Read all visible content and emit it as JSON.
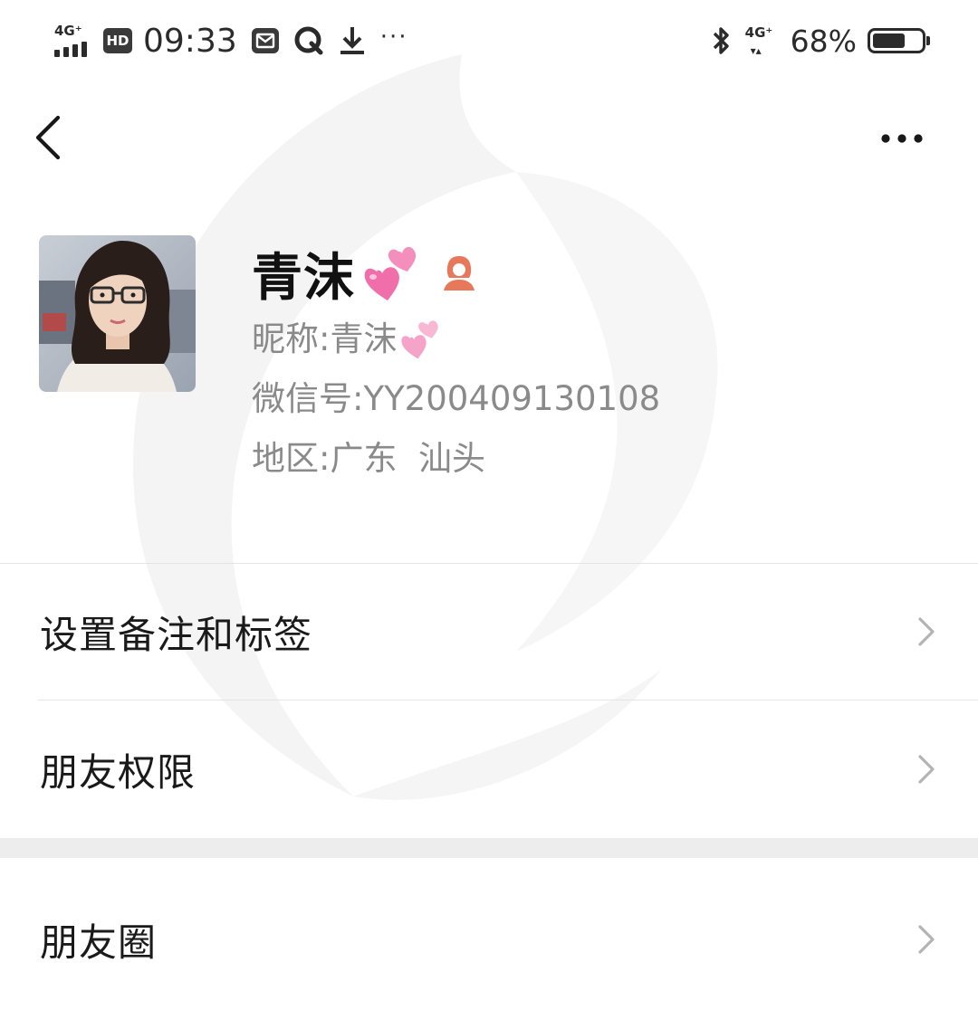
{
  "status_bar": {
    "network_left": "4G⁺",
    "hd": "HD",
    "time": "09:33",
    "more": "···",
    "network_right": "4G⁺",
    "battery_percent": "68%",
    "battery_level": 0.68,
    "icons": [
      "signal-icon",
      "hd-icon",
      "mail-icon",
      "q-app-icon",
      "download-icon",
      "more-dots-icon",
      "bluetooth-icon",
      "mobile-data-icon",
      "battery-icon"
    ]
  },
  "nav": {
    "back_icon": "chevron-left-icon",
    "more_icon": "more-horizontal-icon"
  },
  "profile": {
    "name": "青沫",
    "nickname_label": "昵称: ",
    "nickname_value": "青沫",
    "wechat_id_label": "微信号: ",
    "wechat_id_value": "YY200409130108",
    "region_label": "地区: ",
    "region_value": "广东  汕头",
    "gender_icon": "female-icon",
    "emoji": "two-hearts-emoji"
  },
  "menu": {
    "items": [
      {
        "label": "设置备注和标签"
      },
      {
        "label": "朋友权限"
      },
      {
        "label": "朋友圈"
      }
    ]
  },
  "colors": {
    "text_primary": "#111111",
    "text_secondary": "#8a8a8a",
    "divider": "#e4e4e4",
    "section_gap": "#ededed",
    "heart_pink": "#f06ea9",
    "gender_icon": "#e8785a"
  }
}
